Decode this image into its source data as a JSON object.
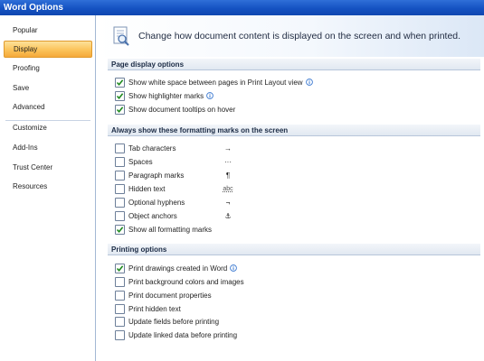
{
  "window": {
    "title": "Word Options"
  },
  "sidebar": {
    "items": [
      {
        "label": "Popular"
      },
      {
        "label": "Display",
        "selected": true
      },
      {
        "label": "Proofing"
      },
      {
        "label": "Save"
      },
      {
        "label": "Advanced"
      },
      {
        "label": "Customize"
      },
      {
        "label": "Add-Ins"
      },
      {
        "label": "Trust Center"
      },
      {
        "label": "Resources"
      }
    ]
  },
  "header": {
    "text": "Change how document content is displayed on the screen and when printed.",
    "icon": "monitor-document-icon"
  },
  "sections": {
    "page_display": {
      "title": "Page display options",
      "options": [
        {
          "label": "Show white space between pages in Print Layout view",
          "checked": true,
          "info": true
        },
        {
          "label": "Show highlighter marks",
          "checked": true,
          "info": true
        },
        {
          "label": "Show document tooltips on hover",
          "checked": true,
          "info": false
        }
      ]
    },
    "formatting_marks": {
      "title": "Always show these formatting marks on the screen",
      "options": [
        {
          "label": "Tab characters",
          "checked": false,
          "symbol": "→"
        },
        {
          "label": "Spaces",
          "checked": false,
          "symbol": "···"
        },
        {
          "label": "Paragraph marks",
          "checked": false,
          "symbol": "¶"
        },
        {
          "label": "Hidden text",
          "checked": false,
          "symbol": "abc"
        },
        {
          "label": "Optional hyphens",
          "checked": false,
          "symbol": "¬"
        },
        {
          "label": "Object anchors",
          "checked": false,
          "symbol": "⚓"
        },
        {
          "label": "Show all formatting marks",
          "checked": true,
          "symbol": ""
        }
      ]
    },
    "printing": {
      "title": "Printing options",
      "options": [
        {
          "label": "Print drawings created in Word",
          "checked": true,
          "info": true
        },
        {
          "label": "Print background colors and images",
          "checked": false,
          "info": false
        },
        {
          "label": "Print document properties",
          "checked": false,
          "info": false
        },
        {
          "label": "Print hidden text",
          "checked": false,
          "info": false
        },
        {
          "label": "Update fields before printing",
          "checked": false,
          "info": false
        },
        {
          "label": "Update linked data before printing",
          "checked": false,
          "info": false
        }
      ]
    }
  },
  "colors": {
    "title_bar": "#1552c2",
    "selected_nav": "#fbc35a",
    "section_header": "#e1e8f1",
    "info_icon": "#3a78d0"
  }
}
